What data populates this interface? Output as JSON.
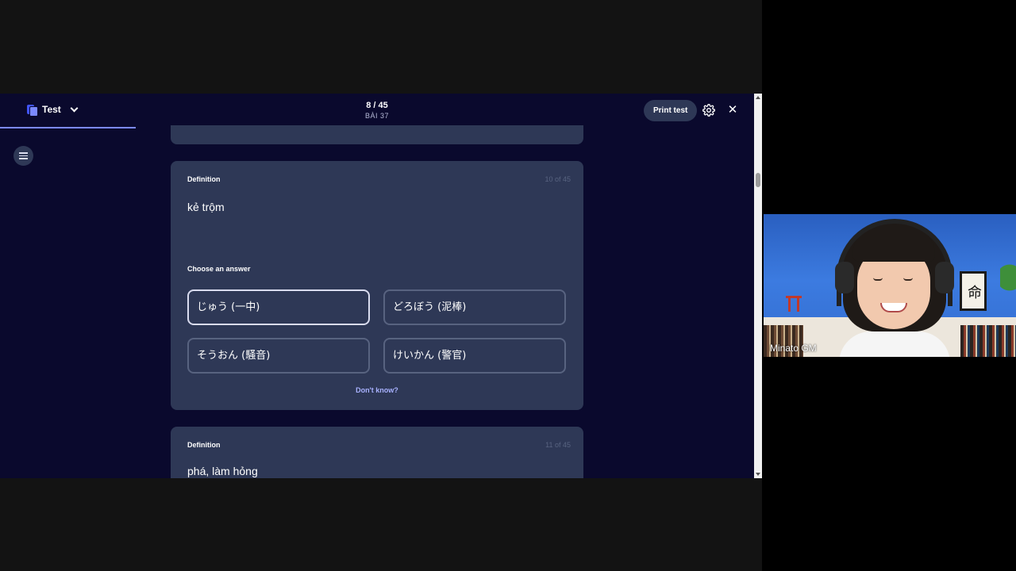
{
  "topbar": {
    "mode_label": "Test",
    "progress_count": "8 / 45",
    "progress_sub": "BÀI 37",
    "print_label": "Print test"
  },
  "cards": {
    "main": {
      "label": "Definition",
      "number": "10 of 45",
      "term": "kẻ trộm",
      "choose_label": "Choose an answer",
      "options": [
        "じゅう (一中)",
        "どろぼう (泥棒)",
        "そうおん (騒音)",
        "けいかん (警官)"
      ],
      "dont_know": "Don't know?"
    },
    "next": {
      "label": "Definition",
      "number": "11 of 45",
      "term": "phá, làm hỏng"
    }
  },
  "video": {
    "participant_name": "Minato GM",
    "frame_glyph": "命"
  },
  "colors": {
    "app_bg": "#0a092d",
    "card_bg": "#2e3856",
    "accent": "#4255ff",
    "link": "#a8b1ff"
  },
  "icons": [
    "doc-icon",
    "chevron-down-icon",
    "gear-icon",
    "close-icon",
    "list-icon"
  ]
}
